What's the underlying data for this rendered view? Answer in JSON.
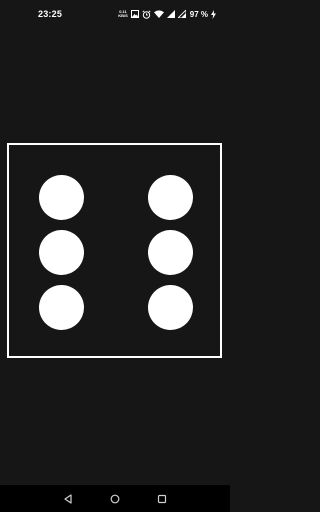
{
  "status_bar": {
    "time": "23:25",
    "net_speed_value": "0.11",
    "net_speed_unit": "KB/S",
    "icons": [
      "image-icon",
      "alarm-icon",
      "wifi-icon",
      "signal-icon",
      "signal-icon-2"
    ],
    "battery_percent": "97 %",
    "charging_icon": "bolt-icon"
  },
  "die": {
    "value": 6,
    "pips": [
      "top-left",
      "middle-left",
      "bottom-left",
      "top-right",
      "middle-right",
      "bottom-right"
    ]
  },
  "nav_bar": {
    "buttons": [
      "back-icon",
      "home-icon",
      "recents-icon"
    ]
  },
  "colors": {
    "background": "#161616",
    "foreground": "#ffffff",
    "nav_background": "#000000"
  }
}
